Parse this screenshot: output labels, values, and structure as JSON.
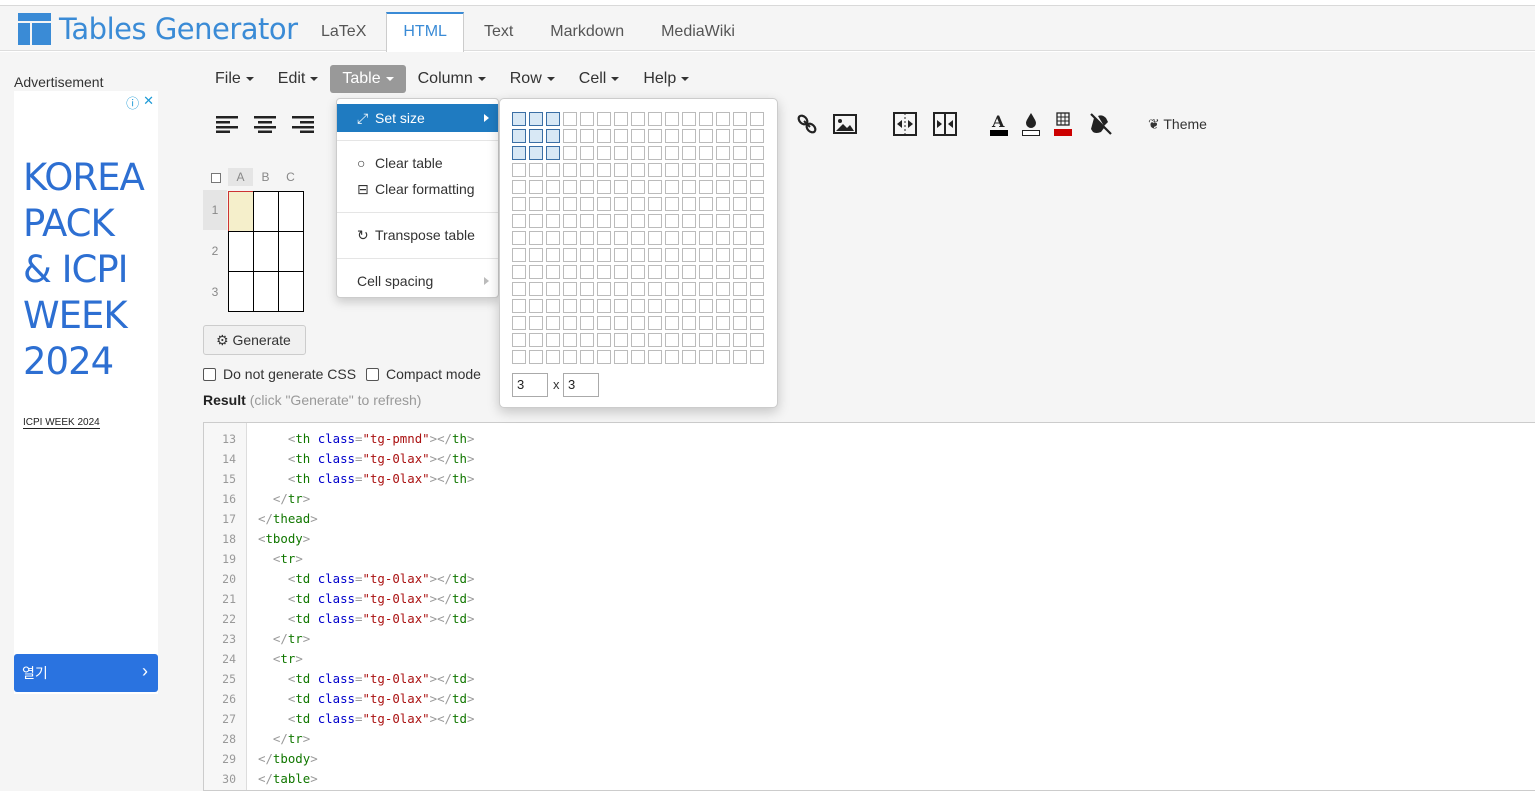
{
  "brand": {
    "name": "Tables Generator",
    "accent": "#3a8bd6"
  },
  "tabs": [
    {
      "label": "LaTeX",
      "active": false
    },
    {
      "label": "HTML",
      "active": true
    },
    {
      "label": "Text",
      "active": false
    },
    {
      "label": "Markdown",
      "active": false
    },
    {
      "label": "MediaWiki",
      "active": false
    }
  ],
  "ad": {
    "label": "Advertisement",
    "headline": [
      "KOREA",
      "PACK",
      "& ICPI",
      "WEEK",
      "2024"
    ],
    "small": "ICPI WEEK 2024",
    "open_button": "열기"
  },
  "menubar": [
    {
      "label": "File",
      "open": false
    },
    {
      "label": "Edit",
      "open": false
    },
    {
      "label": "Table",
      "open": true
    },
    {
      "label": "Column",
      "open": false
    },
    {
      "label": "Row",
      "open": false
    },
    {
      "label": "Cell",
      "open": false
    },
    {
      "label": "Help",
      "open": false
    }
  ],
  "toolbar": {
    "icons": [
      "align-left-icon",
      "align-center-icon",
      "align-right-icon",
      "link-icon",
      "image-icon",
      "merge-cells-icon",
      "split-cells-icon",
      "text-color-icon",
      "background-color-icon",
      "border-color-icon",
      "clear-style-icon"
    ],
    "theme_label": "Theme"
  },
  "table_menu": {
    "items": [
      {
        "label": "Set size",
        "icon": "resize-icon",
        "active": true,
        "submenu": true
      },
      {
        "label": "Clear table",
        "icon": "circle-icon"
      },
      {
        "label": "Clear formatting",
        "icon": "minus-box-icon"
      },
      {
        "label": "Transpose table",
        "icon": "refresh-icon"
      },
      {
        "label": "Cell spacing",
        "submenu": true
      }
    ]
  },
  "size_picker": {
    "rows": 3,
    "cols": 3,
    "grid_rows": 15,
    "grid_cols": 15,
    "rows_value": "3",
    "cols_value": "3",
    "separator": "x"
  },
  "editor": {
    "col_headers": [
      "A",
      "B",
      "C"
    ],
    "row_headers": [
      "1",
      "2",
      "3"
    ]
  },
  "generate_button": "Generate",
  "options": [
    {
      "label": "Do not generate CSS",
      "checked": false
    },
    {
      "label": "Compact mode",
      "checked": false
    }
  ],
  "result": {
    "label": "Result",
    "hint": "(click \"Generate\" to refresh)"
  },
  "code_lines": [
    {
      "n": "13",
      "indent": 4,
      "kind": "open",
      "tag": "th",
      "cls": "tg-pmnd"
    },
    {
      "n": "14",
      "indent": 4,
      "kind": "open",
      "tag": "th",
      "cls": "tg-0lax"
    },
    {
      "n": "15",
      "indent": 4,
      "kind": "open",
      "tag": "th",
      "cls": "tg-0lax"
    },
    {
      "n": "16",
      "indent": 2,
      "kind": "close",
      "tag": "tr"
    },
    {
      "n": "17",
      "indent": 0,
      "kind": "close",
      "tag": "thead"
    },
    {
      "n": "18",
      "indent": 0,
      "kind": "start",
      "tag": "tbody"
    },
    {
      "n": "19",
      "indent": 2,
      "kind": "start",
      "tag": "tr"
    },
    {
      "n": "20",
      "indent": 4,
      "kind": "open",
      "tag": "td",
      "cls": "tg-0lax"
    },
    {
      "n": "21",
      "indent": 4,
      "kind": "open",
      "tag": "td",
      "cls": "tg-0lax"
    },
    {
      "n": "22",
      "indent": 4,
      "kind": "open",
      "tag": "td",
      "cls": "tg-0lax"
    },
    {
      "n": "23",
      "indent": 2,
      "kind": "close",
      "tag": "tr"
    },
    {
      "n": "24",
      "indent": 2,
      "kind": "start",
      "tag": "tr"
    },
    {
      "n": "25",
      "indent": 4,
      "kind": "open",
      "tag": "td",
      "cls": "tg-0lax"
    },
    {
      "n": "26",
      "indent": 4,
      "kind": "open",
      "tag": "td",
      "cls": "tg-0lax"
    },
    {
      "n": "27",
      "indent": 4,
      "kind": "open",
      "tag": "td",
      "cls": "tg-0lax"
    },
    {
      "n": "28",
      "indent": 2,
      "kind": "close",
      "tag": "tr"
    },
    {
      "n": "29",
      "indent": 0,
      "kind": "close",
      "tag": "tbody"
    },
    {
      "n": "30",
      "indent": 0,
      "kind": "close",
      "tag": "table"
    }
  ]
}
